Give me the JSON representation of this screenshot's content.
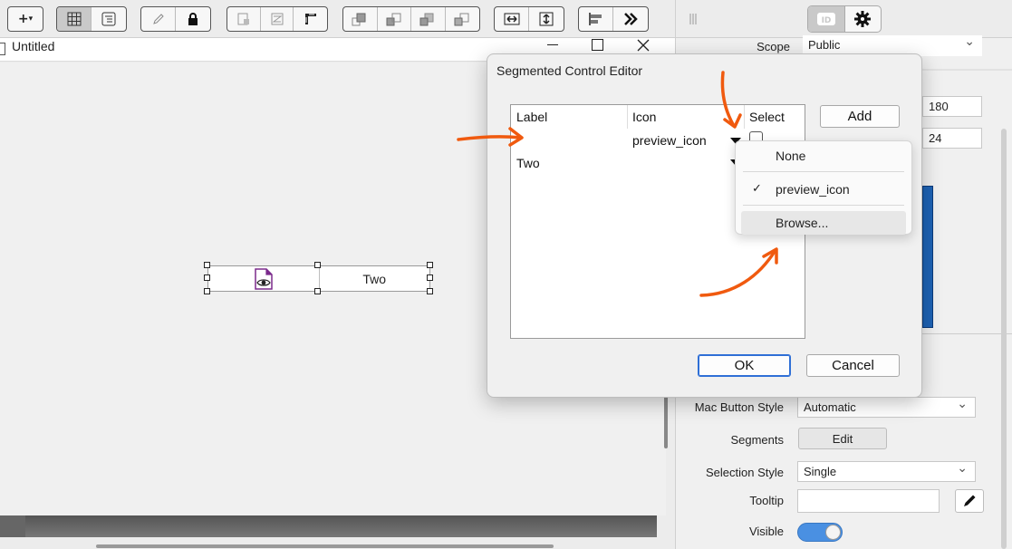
{
  "document": {
    "title": "Untitled"
  },
  "canvas": {
    "segment_two_label": "Two"
  },
  "inspector": {
    "scope_label": "Scope",
    "scope_value": "Public",
    "width_value": "180",
    "height_value": "24",
    "mac_button_style_label": "Mac Button Style",
    "mac_button_style_value": "Automatic",
    "segments_label": "Segments",
    "segments_button": "Edit",
    "selection_style_label": "Selection Style",
    "selection_style_value": "Single",
    "tooltip_label": "Tooltip",
    "tooltip_value": "",
    "visible_label": "Visible",
    "visible_on": true,
    "accent_color": "#4a90e2"
  },
  "dialog": {
    "title": "Segmented Control Editor",
    "columns": [
      "Label",
      "Icon",
      "Select"
    ],
    "rows": [
      {
        "label": "",
        "icon": "preview_icon",
        "selected": false
      },
      {
        "label": "Two",
        "icon": "",
        "selected": false
      }
    ],
    "add_button": "Add",
    "ok_button": "OK",
    "cancel_button": "Cancel"
  },
  "icon_menu": {
    "items": [
      {
        "label": "None",
        "checked": false
      },
      {
        "label": "preview_icon",
        "checked": true
      },
      {
        "label": "Browse...",
        "checked": false
      }
    ]
  },
  "colors": {
    "annotation": "#f05a0f",
    "primary_button": "#2f6fd6",
    "selection_blue": "#1e63b5"
  }
}
